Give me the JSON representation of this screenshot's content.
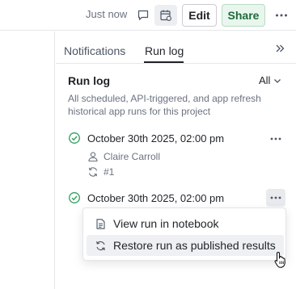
{
  "topbar": {
    "timestamp": "Just now",
    "edit_label": "Edit",
    "share_label": "Share",
    "icons": [
      "comment-icon",
      "calendar-icon",
      "more-icon"
    ]
  },
  "tabs": [
    {
      "label": "Notifications",
      "active": false
    },
    {
      "label": "Run log",
      "active": true
    }
  ],
  "panel": {
    "title": "Run log",
    "filter_value": "All",
    "description": "All scheduled, API-triggered, and app refresh historical app runs for this project"
  },
  "runs": [
    {
      "datetime": "October 30th 2025, 02:00 pm",
      "status": "success",
      "user": "Claire Carroll",
      "run_number": "#1"
    },
    {
      "datetime": "October 30th 2025, 02:00 pm",
      "status": "success"
    }
  ],
  "menu": {
    "items": [
      {
        "label": "View run in notebook",
        "icon": "notebook-icon"
      },
      {
        "label": "Restore run as published results",
        "icon": "restore-icon"
      }
    ]
  },
  "colors": {
    "success": "#2e9e5b",
    "share_bg": "#e9f6ed",
    "share_text": "#1d6b3c"
  }
}
